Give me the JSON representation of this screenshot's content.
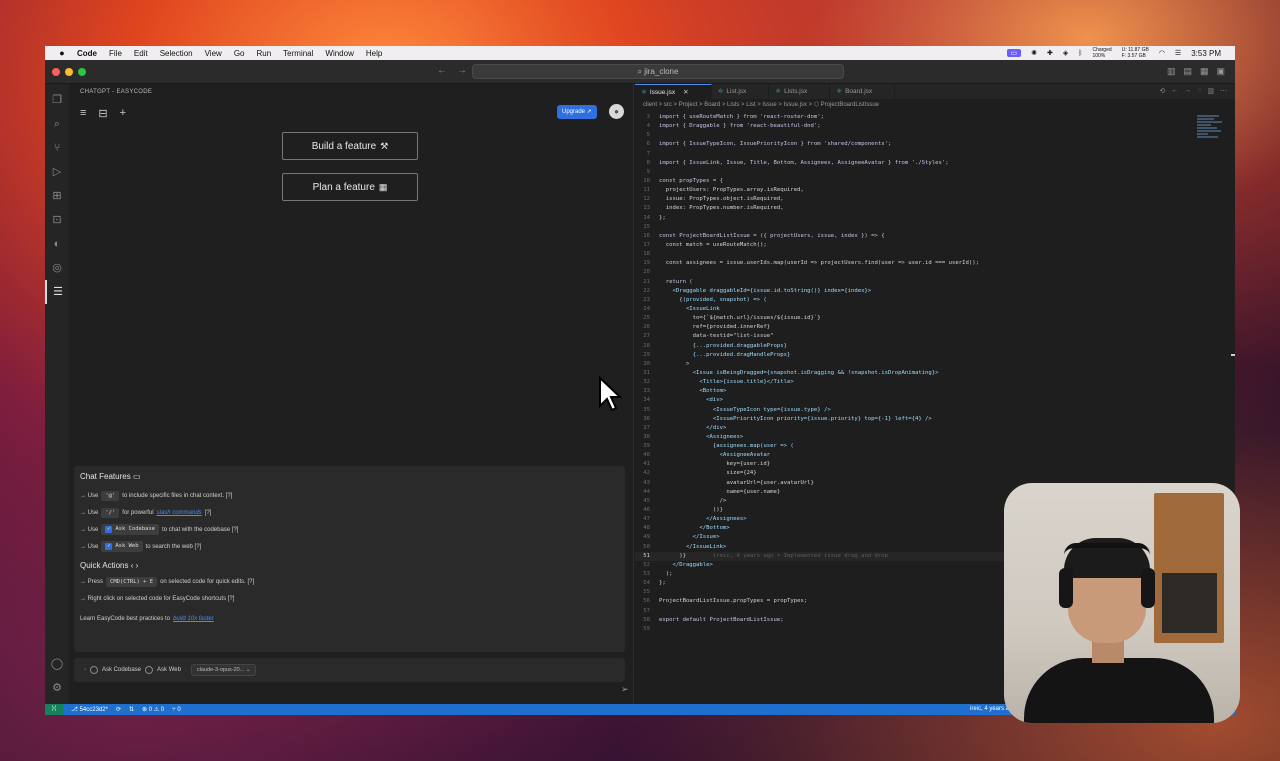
{
  "menubar": {
    "apple": "",
    "items": [
      "Code",
      "File",
      "Edit",
      "Selection",
      "View",
      "Go",
      "Run",
      "Terminal",
      "Window",
      "Help"
    ],
    "battery_line1": "Charged",
    "battery_line2": "100%",
    "mem_line1": "U: 11.87 GB",
    "mem_line2": "F: 3.57 GB",
    "clock": "3:53 PM"
  },
  "titlebar": {
    "search": "⌕ jira_clone"
  },
  "chat": {
    "title": "CHATGPT - EASYCODE",
    "upgrade_label": "Upgrade",
    "build_feature": "Build a feature",
    "plan_feature": "Plan a feature",
    "features_heading": "Chat Features",
    "f1_pre": "→ Use",
    "f1_chip": "'@'",
    "f1_post": "to include specific files in chat context. [?]",
    "f2_pre": "→ Use",
    "f2_chip": "'/'",
    "f2_mid": "for powerful",
    "f2_link": "slash commands",
    "f2_post": "[?]",
    "f3_pre": "→ Use",
    "f3_chip": "Ask Codebase",
    "f3_post": "to chat with the codebase [?]",
    "f4_pre": "→ Use",
    "f4_chip": "Ask Web",
    "f4_post": "to search the web [?]",
    "quick_heading": "Quick Actions",
    "qa1_pre": "→ Press",
    "qa1_chip": "CMD(CTRL) + E",
    "qa1_post": "on selected code for quick edits. [?]",
    "qa2": "→ Right click on selected code for EasyCode shortcuts [?]",
    "learn_pre": "Learn EasyCode best practices to",
    "learn_link": "build 10x faster",
    "ask_codebase": "Ask Codebase",
    "ask_web": "Ask Web",
    "model": "claude-3-opus-20..."
  },
  "editor": {
    "tabs": [
      {
        "label": "Issue.jsx",
        "active": true
      },
      {
        "label": "List.jsx",
        "active": false
      },
      {
        "label": "Lists.jsx",
        "active": false
      },
      {
        "label": "Board.jsx",
        "active": false
      }
    ],
    "breadcrumb": "client > src > Project > Board > Lists > List > Issue > Issue.jsx > ⬡ ProjectBoardListIssue",
    "current_line": 51,
    "lines": [
      {
        "n": "3",
        "t": "import { useRouteMatch } from 'react-router-dom';"
      },
      {
        "n": "4",
        "t": "import { Draggable } from 'react-beautiful-dnd';"
      },
      {
        "n": "5",
        "t": ""
      },
      {
        "n": "6",
        "t": "import { IssueTypeIcon, IssuePriorityIcon } from 'shared/components';"
      },
      {
        "n": "7",
        "t": ""
      },
      {
        "n": "8",
        "t": "import { IssueLink, Issue, Title, Bottom, Assignees, AssigneeAvatar } from './Styles';"
      },
      {
        "n": "9",
        "t": ""
      },
      {
        "n": "10",
        "t": "const propTypes = {"
      },
      {
        "n": "11",
        "t": "  projectUsers: PropTypes.array.isRequired,"
      },
      {
        "n": "12",
        "t": "  issue: PropTypes.object.isRequired,"
      },
      {
        "n": "13",
        "t": "  index: PropTypes.number.isRequired,"
      },
      {
        "n": "14",
        "t": "};"
      },
      {
        "n": "15",
        "t": ""
      },
      {
        "n": "16",
        "t": "const ProjectBoardListIssue = ({ projectUsers, issue, index }) => {"
      },
      {
        "n": "17",
        "t": "  const match = useRouteMatch();"
      },
      {
        "n": "18",
        "t": ""
      },
      {
        "n": "19",
        "t": "  const assignees = issue.userIds.map(userId => projectUsers.find(user => user.id === userId));"
      },
      {
        "n": "20",
        "t": ""
      },
      {
        "n": "21",
        "t": "  return ("
      },
      {
        "n": "22",
        "t": "    <Draggable draggableId={issue.id.toString()} index={index}>"
      },
      {
        "n": "23",
        "t": "      {(provided, snapshot) => ("
      },
      {
        "n": "24",
        "t": "        <IssueLink"
      },
      {
        "n": "25",
        "t": "          to={`${match.url}/issues/${issue.id}`}"
      },
      {
        "n": "26",
        "t": "          ref={provided.innerRef}"
      },
      {
        "n": "27",
        "t": "          data-testid=\"list-issue\""
      },
      {
        "n": "28",
        "t": "          {...provided.draggableProps}"
      },
      {
        "n": "29",
        "t": "          {...provided.dragHandleProps}"
      },
      {
        "n": "30",
        "t": "        >"
      },
      {
        "n": "31",
        "t": "          <Issue isBeingDragged={snapshot.isDragging && !snapshot.isDropAnimating}>"
      },
      {
        "n": "32",
        "t": "            <Title>{issue.title}</Title>"
      },
      {
        "n": "33",
        "t": "            <Bottom>"
      },
      {
        "n": "34",
        "t": "              <div>"
      },
      {
        "n": "35",
        "t": "                <IssueTypeIcon type={issue.type} />"
      },
      {
        "n": "36",
        "t": "                <IssuePriorityIcon priority={issue.priority} top={-1} left={4} />"
      },
      {
        "n": "37",
        "t": "              </div>"
      },
      {
        "n": "38",
        "t": "              <Assignees>"
      },
      {
        "n": "39",
        "t": "                {assignees.map(user => ("
      },
      {
        "n": "40",
        "t": "                  <AssigneeAvatar"
      },
      {
        "n": "41",
        "t": "                    key={user.id}"
      },
      {
        "n": "42",
        "t": "                    size={24}"
      },
      {
        "n": "43",
        "t": "                    avatarUrl={user.avatarUrl}"
      },
      {
        "n": "44",
        "t": "                    name={user.name}"
      },
      {
        "n": "45",
        "t": "                  />"
      },
      {
        "n": "46",
        "t": "                ))}"
      },
      {
        "n": "47",
        "t": "              </Assignees>"
      },
      {
        "n": "48",
        "t": "            </Bottom>"
      },
      {
        "n": "49",
        "t": "          </Issue>"
      },
      {
        "n": "50",
        "t": "        </IssueLink>"
      },
      {
        "n": "51",
        "t": "      )}        ireic, 4 years ago • Implemented issue drag and drop"
      },
      {
        "n": "52",
        "t": "    </Draggable>"
      },
      {
        "n": "53",
        "t": "  );"
      },
      {
        "n": "54",
        "t": "};"
      },
      {
        "n": "55",
        "t": ""
      },
      {
        "n": "56",
        "t": "ProjectBoardListIssue.propTypes = propTypes;"
      },
      {
        "n": "57",
        "t": ""
      },
      {
        "n": "58",
        "t": "export default ProjectBoardListIssue;"
      },
      {
        "n": "59",
        "t": ""
      }
    ]
  },
  "statusbar": {
    "branch": "⎇ 54cc23d2*",
    "problems": "⊗ 0 ⚠ 0",
    "ports": "⑂ 0",
    "blame": "ireic, 4 years ag"
  },
  "colors": {
    "accent": "#2f6fe0",
    "statusbar": "#1f6fcf",
    "editor_bg": "#1e1e1e"
  }
}
